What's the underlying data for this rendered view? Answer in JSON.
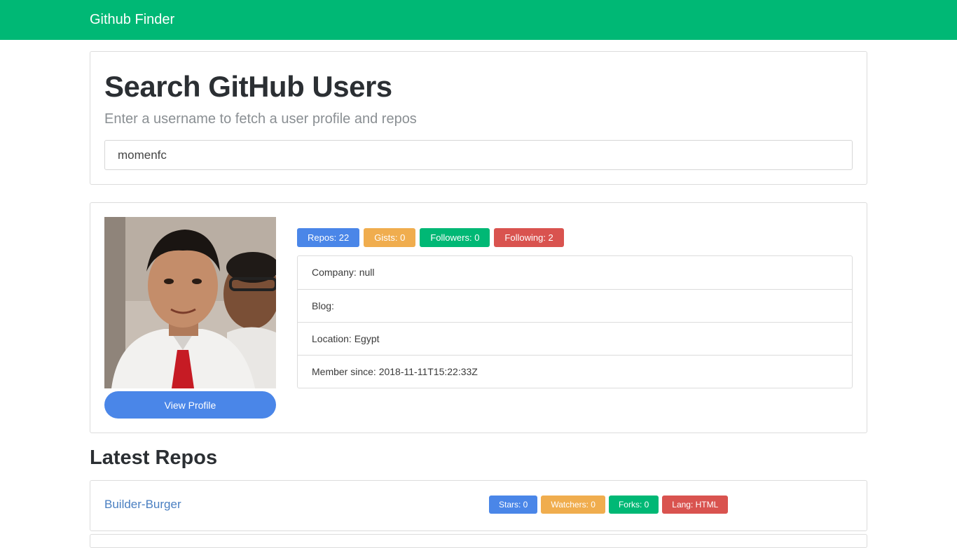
{
  "navbar": {
    "brand": "Github Finder"
  },
  "search": {
    "title": "Search GitHub Users",
    "subtitle": "Enter a username to fetch a user profile and repos",
    "value": "momenfc"
  },
  "profile": {
    "view_profile_label": "View Profile",
    "badges": {
      "repos": "Repos: 22",
      "gists": "Gists: 0",
      "followers": "Followers: 0",
      "following": "Following: 2"
    },
    "info": {
      "company": "Company: null",
      "blog": "Blog:",
      "location": "Location: Egypt",
      "member_since": "Member since: 2018-11-11T15:22:33Z"
    }
  },
  "repos": {
    "title": "Latest Repos",
    "items": [
      {
        "name": "Builder-Burger",
        "stars": "Stars: 0",
        "watchers": "Watchers: 0",
        "forks": "Forks: 0",
        "lang": "Lang: HTML"
      }
    ]
  },
  "colors": {
    "navbar": "#00b875",
    "primary": "#4a86e8",
    "warning": "#f0ad4e",
    "success": "#00b875",
    "danger": "#d9534f",
    "link": "#4a7fc1"
  },
  "icons": {
    "avatar": "user-avatar-photo"
  }
}
